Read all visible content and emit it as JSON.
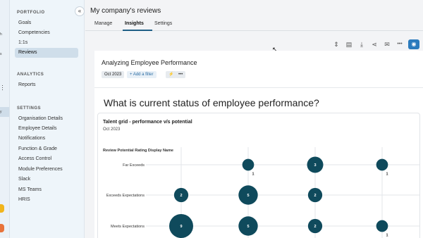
{
  "rail": {
    "fragments": [
      "h",
      "s",
      "y"
    ]
  },
  "sidebar": {
    "portfolio_heading": "PORTFOLIO",
    "portfolio_items": [
      "Goals",
      "Competencies",
      "1:1s",
      "Reviews"
    ],
    "active_item": "Reviews",
    "analytics_heading": "ANALYTICS",
    "analytics_items": [
      "Reports"
    ],
    "settings_heading": "SETTINGS",
    "settings_items": [
      "Organisation Details",
      "Employee Details",
      "Notifications",
      "Function & Grade",
      "Access Control",
      "Module Preferences",
      "Slack",
      "MS Teams",
      "HRIS"
    ],
    "collapse_icon": "«"
  },
  "header": {
    "title": "My company's reviews",
    "tabs": [
      "Manage",
      "Insights",
      "Settings"
    ],
    "active_tab": "Insights"
  },
  "toolbar": {
    "icons": [
      "move-icon",
      "comment-icon",
      "download-icon",
      "share-icon",
      "mail-icon",
      "more-icon",
      "camera-icon"
    ],
    "glyphs": [
      "⇕",
      "▤",
      "⤓",
      "⋖",
      "✉",
      "•••",
      "◉"
    ]
  },
  "analysis": {
    "title": "Analyzing Employee Performance",
    "date_chip": "Oct 2023",
    "add_filter": "+ Add a filter",
    "bolt_icon": "⚡",
    "more_icon": "•••"
  },
  "question": "What is current status of employee performance?",
  "card": {
    "title": "Talent grid - performance v/s potential",
    "subtitle": "Oct 2023",
    "axis_title": "Review Potential Rating Display Name"
  },
  "chart_data": {
    "type": "scatter",
    "title": "Talent grid - performance v/s potential",
    "ylabel": "Review Potential Rating Display Name",
    "y_categories": [
      "Far Exceeds",
      "Exceeds Expectations",
      "Meets Expectations"
    ],
    "x_column_count": 4,
    "points": [
      {
        "row": "Far Exceeds",
        "col": 2,
        "count": 1,
        "label_position": "below"
      },
      {
        "row": "Far Exceeds",
        "col": 3,
        "count": 3,
        "label_position": "inside"
      },
      {
        "row": "Far Exceeds",
        "col": 4,
        "count": 1,
        "label_position": "below"
      },
      {
        "row": "Exceeds Expectations",
        "col": 1,
        "count": 2,
        "label_position": "inside"
      },
      {
        "row": "Exceeds Expectations",
        "col": 2,
        "count": 5,
        "label_position": "inside"
      },
      {
        "row": "Exceeds Expectations",
        "col": 3,
        "count": 2,
        "label_position": "inside"
      },
      {
        "row": "Meets Expectations",
        "col": 1,
        "count": 9,
        "label_position": "inside"
      },
      {
        "row": "Meets Expectations",
        "col": 2,
        "count": 5,
        "label_position": "inside"
      },
      {
        "row": "Meets Expectations",
        "col": 3,
        "count": 2,
        "label_position": "inside"
      },
      {
        "row": "Meets Expectations",
        "col": 4,
        "count": 1,
        "label_position": "below"
      }
    ],
    "bubble_color": "#0f4a5c",
    "grid": true
  }
}
